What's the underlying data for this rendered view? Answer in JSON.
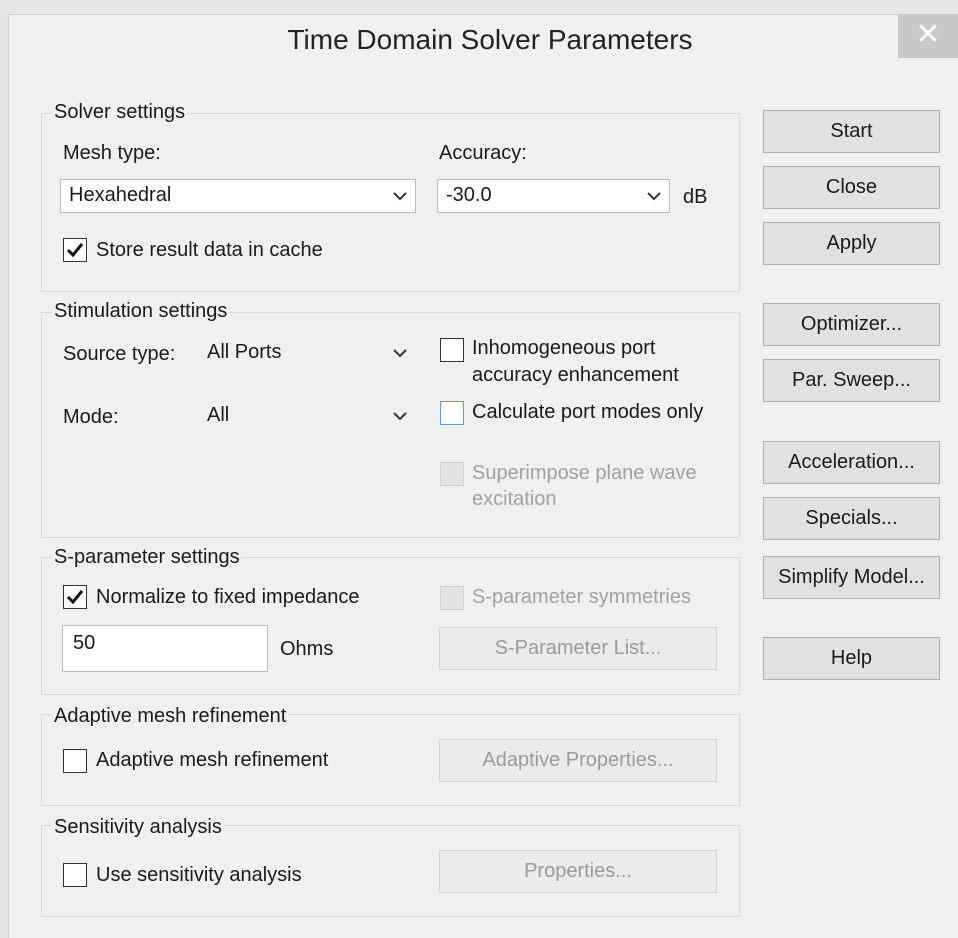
{
  "dialog": {
    "title": "Time Domain Solver Parameters",
    "close_glyph": "✕"
  },
  "solver_settings": {
    "legend": "Solver settings",
    "mesh_type_label": "Mesh type:",
    "mesh_type_value": "Hexahedral",
    "accuracy_label": "Accuracy:",
    "accuracy_value": "-30.0",
    "accuracy_unit": "dB",
    "store_cache_label": "Store result data in cache",
    "store_cache_checked": true
  },
  "stimulation_settings": {
    "legend": "Stimulation settings",
    "source_type_label": "Source type:",
    "source_type_value": "All Ports",
    "mode_label": "Mode:",
    "mode_value": "All",
    "inhomogeneous_line1": "Inhomogeneous port",
    "inhomogeneous_line2": "accuracy enhancement",
    "calc_port_modes_label": "Calculate port modes only",
    "superimpose_line1": "Superimpose plane wave",
    "superimpose_line2": "excitation"
  },
  "sparameter_settings": {
    "legend": "S-parameter settings",
    "normalize_label": "Normalize to fixed impedance",
    "normalize_checked": true,
    "symmetries_label": "S-parameter symmetries",
    "impedance_value": "50",
    "impedance_unit": "Ohms",
    "list_button": "S-Parameter List..."
  },
  "adaptive_mesh": {
    "legend": "Adaptive mesh refinement",
    "checkbox_label": "Adaptive mesh refinement",
    "properties_button": "Adaptive Properties..."
  },
  "sensitivity": {
    "legend": "Sensitivity analysis",
    "checkbox_label": "Use sensitivity analysis",
    "properties_button": "Properties..."
  },
  "side_buttons": {
    "start": "Start",
    "close": "Close",
    "apply": "Apply",
    "optimizer": "Optimizer...",
    "par_sweep": "Par. Sweep...",
    "acceleration": "Acceleration...",
    "specials": "Specials...",
    "simplify_model": "Simplify Model...",
    "help": "Help"
  }
}
